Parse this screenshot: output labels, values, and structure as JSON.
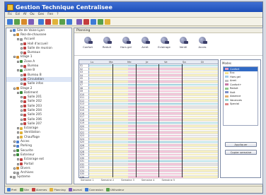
{
  "window": {
    "title": "Gestion Technique Centralisee"
  },
  "menubar": [
    "Fic",
    "Ed",
    "Af",
    "Ou",
    "Ges",
    "Fen",
    "?"
  ],
  "toolbar": {
    "icon_colors": [
      "#3d7ad6",
      "#58a04a",
      "#d88a2a",
      "#7c5cb8",
      "#3d7ad6",
      "#c43c3c",
      "#e0b23a",
      "#58a04a",
      "#3d7ad6",
      "#7c5cb8",
      "#c43c3c",
      "#3d7ad6",
      "#58a04a",
      "#e0b23a"
    ]
  },
  "tree": {
    "items": [
      {
        "label": "Site de Vaise-Lyon",
        "color": "#4a7fd0",
        "indent": 1
      },
      {
        "label": "Rez-de-chaussee",
        "color": "#d08a2a",
        "indent": 2
      },
      {
        "label": "Accueil",
        "color": "#9a9a9a",
        "indent": 3
      },
      {
        "label": "Hall d'accueil",
        "color": "#c04040",
        "indent": 4
      },
      {
        "label": "Salle de reunion",
        "color": "#c04040",
        "indent": 4
      },
      {
        "label": "Bureaux",
        "color": "#c04040",
        "indent": 4
      },
      {
        "label": "Etage 1",
        "color": "#d08a2a",
        "indent": 2
      },
      {
        "label": "Zone A",
        "color": "#3a8a3a",
        "indent": 3
      },
      {
        "label": "Bureau",
        "color": "#c04040",
        "indent": 4
      },
      {
        "label": "Zone B",
        "color": "#3a8a3a",
        "indent": 3
      },
      {
        "label": "Bureau B",
        "color": "#c04040",
        "indent": 4
      },
      {
        "label": "Circulation",
        "color": "#c04040",
        "indent": 4
      },
      {
        "label": "Salle infos",
        "color": "#c04040",
        "indent": 4
      },
      {
        "label": "Etage 2",
        "color": "#d08a2a",
        "indent": 2
      },
      {
        "label": "Batiment",
        "color": "#3a8a3a",
        "indent": 3
      },
      {
        "label": "Salle 201",
        "color": "#c04040",
        "indent": 4
      },
      {
        "label": "Salle 202",
        "color": "#c04040",
        "indent": 4
      },
      {
        "label": "Salle 203",
        "color": "#c04040",
        "indent": 4
      },
      {
        "label": "Salle 204",
        "color": "#c04040",
        "indent": 4
      },
      {
        "label": "Salle 205",
        "color": "#c04040",
        "indent": 4
      },
      {
        "label": "Salle 206",
        "color": "#c04040",
        "indent": 4
      },
      {
        "label": "Salle 207",
        "color": "#c04040",
        "indent": 4
      },
      {
        "label": "Eclairage",
        "color": "#e0b23a",
        "indent": 3
      },
      {
        "label": "Ventilation",
        "color": "#e0b23a",
        "indent": 3
      },
      {
        "label": "Chauffage",
        "color": "#e0b23a",
        "indent": 3
      },
      {
        "label": "Acces",
        "color": "#4a7fd0",
        "indent": 2
      },
      {
        "label": "Parking",
        "color": "#4a7fd0",
        "indent": 2
      },
      {
        "label": "Securite",
        "color": "#3a8a3a",
        "indent": 2
      },
      {
        "label": "Exterieur",
        "color": "#3a8a3a",
        "indent": 2
      },
      {
        "label": "Eclairage ext",
        "color": "#c04040",
        "indent": 3
      },
      {
        "label": "Portail",
        "color": "#c04040",
        "indent": 3
      },
      {
        "label": "Divers",
        "color": "#d08a2a",
        "indent": 2
      },
      {
        "label": "Archives",
        "color": "#9a9a9a",
        "indent": 2
      },
      {
        "label": "Systeme",
        "color": "#9a9a9a",
        "indent": 1
      }
    ]
  },
  "right": {
    "section_title": "Planning",
    "icons": [
      "Confort",
      "Reduit",
      "Hors gel",
      "Arret",
      "Eclairage",
      "Ventil",
      "Acces"
    ],
    "plan_head": [
      "Lu",
      "Ma",
      "Me",
      "Je",
      "Ve",
      "Sa",
      "Di"
    ],
    "row_labels": [
      "S1",
      "S2",
      "S3",
      "S4",
      "S5",
      "S6",
      "S7",
      "S8",
      "S9",
      "S10",
      "S11",
      "S12",
      "S13",
      "S14",
      "S15",
      "S16",
      "S17",
      "S18",
      "S19",
      "S20",
      "S21",
      "S22",
      "S23",
      "S24",
      "S25",
      "S26",
      "S27",
      "S28",
      "S29",
      "S30",
      "S31",
      "S32",
      "S33",
      "S34",
      "S35",
      "S36"
    ],
    "bottom_labels": [
      "Semaine 1",
      "Semaine 2",
      "Semaine 3",
      "Semaine 4",
      "Semaine 5"
    ]
  },
  "sidepanel": {
    "title": "Modes",
    "items": [
      {
        "label": "Confort",
        "color": "#e79ac1"
      },
      {
        "label": "Eco",
        "color": "#f3e28e"
      },
      {
        "label": "Hors gel",
        "color": "#a3cde9"
      },
      {
        "label": "Arret",
        "color": "#bdbdbd"
      },
      {
        "label": "Confort+",
        "color": "#c77aa8"
      },
      {
        "label": "Reduit",
        "color": "#8ec98a"
      },
      {
        "label": "Nuit",
        "color": "#7c8fc7"
      },
      {
        "label": "Absence",
        "color": "#e3b070"
      },
      {
        "label": "Vacances",
        "color": "#9ad3cf"
      },
      {
        "label": "Special",
        "color": "#e08a8a"
      }
    ],
    "btn1": "Appliquer",
    "btn2": "Copier semaine"
  },
  "statusbar": [
    {
      "label": "Pret",
      "color": "#3d7ad6"
    },
    {
      "label": "Site",
      "color": "#58a04a"
    },
    {
      "label": "Alarmes",
      "color": "#c43c3c"
    },
    {
      "label": "Planning",
      "color": "#e0b23a"
    },
    {
      "label": "Journal",
      "color": "#7c5cb8"
    },
    {
      "label": "Connexion",
      "color": "#3d7ad6"
    },
    {
      "label": "Utilisateur",
      "color": "#58a04a"
    }
  ]
}
